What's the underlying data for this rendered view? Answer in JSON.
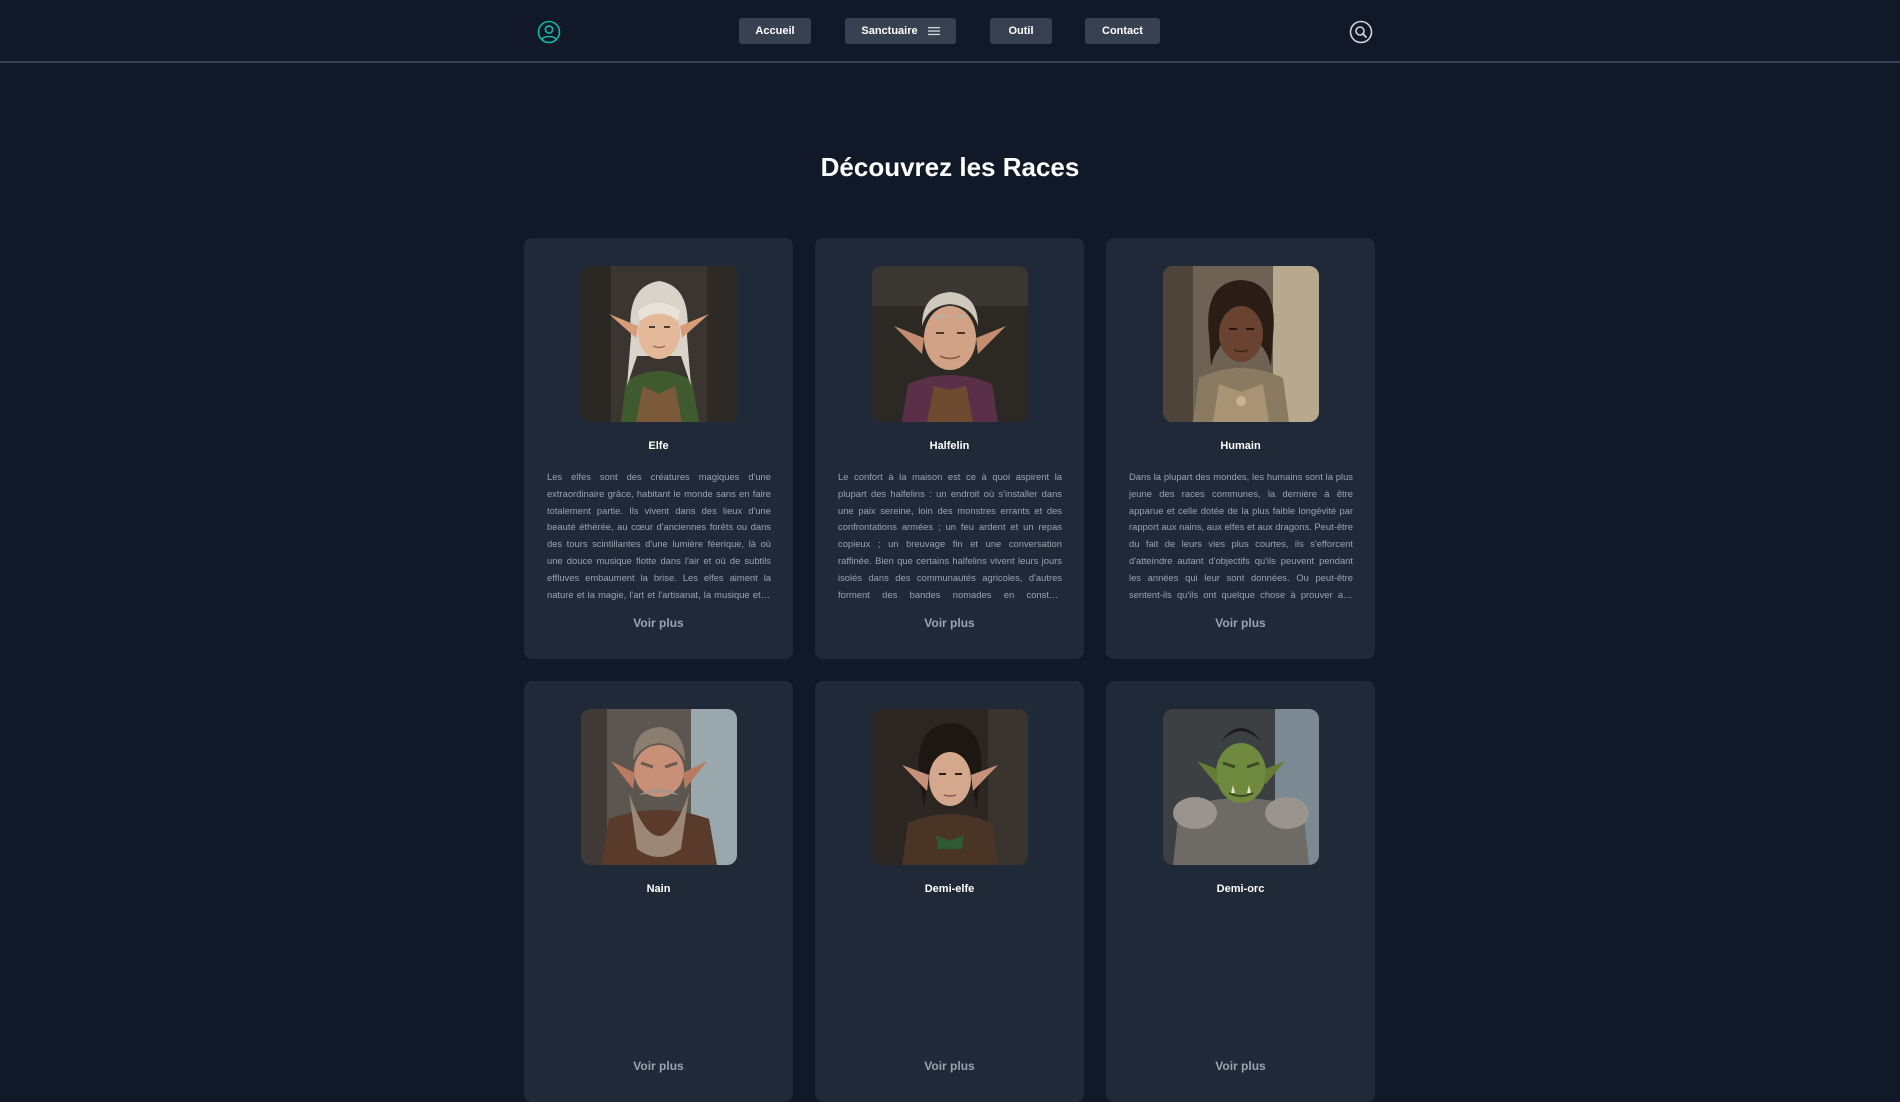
{
  "nav": {
    "user_icon": "user-circle-icon",
    "search_icon": "search-icon",
    "items": [
      {
        "label": "Accueil"
      },
      {
        "label": "Sanctuaire",
        "icon": "menu-icon"
      },
      {
        "label": "Outil"
      },
      {
        "label": "Contact"
      }
    ]
  },
  "page": {
    "title": "Découvrez les Races"
  },
  "races": [
    {
      "name": "Elfe",
      "description": "Les elfes sont des créatures magiques d'une extraordinaire grâce, habitant le monde sans en faire totalement partie. Ils vivent dans des lieux d'une beauté éthérée, au cœur d'anciennes forêts ou dans des tours scintillantes d'une lumière féerique, là où une douce musique flotte dans l'air et où de subtils effluves embaument la brise. Les elfes aiment la nature et la magie, l'art et l'artisanat, la musique et la poésie, ainsi que toutes les bonnes choses de ce monde.",
      "more": "Voir plus"
    },
    {
      "name": "Halfelin",
      "description": "Le confort à la maison est ce à quoi aspirent la plupart des halfelins : un endroit où s'installer dans une paix sereine, loin des monstres errants et des confrontations armées ; un feu ardent et un repas copieux ; un breuvage fin et une conversation raffinée. Bien que certains halfelins vivent leurs jours isolés dans des communautés agricoles, d'autres forment des bandes nomades en constant déplacement.",
      "more": "Voir plus"
    },
    {
      "name": "Humain",
      "description": "Dans la plupart des mondes, les humains sont la plus jeune des races communes, la dernière à être apparue et celle dotée de la plus faible longévité par rapport aux nains, aux elfes et aux dragons. Peut-être du fait de leurs vies plus courtes, ils s'efforcent d'atteindre autant d'objectifs qu'ils peuvent pendant les années qui leur sont données. Ou peut-être sentent-ils qu'ils ont quelque chose à prouver aux races plus anciennes.",
      "more": "Voir plus"
    },
    {
      "name": "Nain",
      "description": "",
      "more": "Voir plus"
    },
    {
      "name": "Demi-elfe",
      "description": "",
      "more": "Voir plus"
    },
    {
      "name": "Demi-orc",
      "description": "",
      "more": "Voir plus"
    }
  ],
  "colors": {
    "background": "#111827",
    "card": "#1f2937",
    "button": "#374151",
    "accent": "#14b8a6",
    "muted_text": "#9ca3af"
  }
}
